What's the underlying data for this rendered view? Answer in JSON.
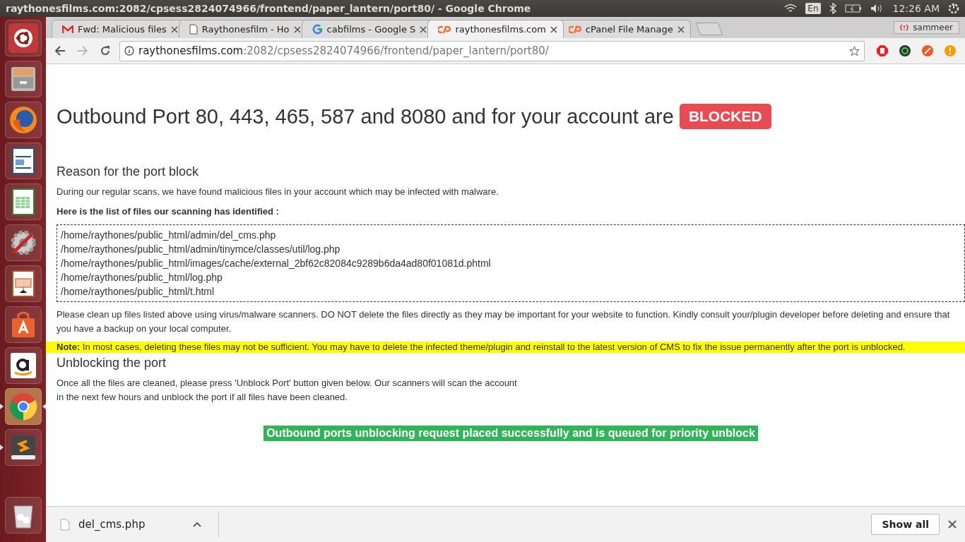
{
  "system_bar": {
    "window_title": "raythonesfilms.com:2082/cpsess2824074966/frontend/paper_lantern/port80/ - Google Chrome",
    "keyboard": "En",
    "time": "12:26 AM"
  },
  "launcher": [
    {
      "kind": "ubuntu",
      "running": false,
      "selected": false
    },
    {
      "kind": "files",
      "running": false,
      "selected": false
    },
    {
      "kind": "firefox",
      "running": false,
      "selected": false
    },
    {
      "kind": "writer",
      "running": false,
      "selected": false
    },
    {
      "kind": "calc",
      "running": false,
      "selected": false
    },
    {
      "kind": "settings",
      "running": false,
      "selected": false
    },
    {
      "kind": "impress",
      "running": false,
      "selected": false
    },
    {
      "kind": "store",
      "running": false,
      "selected": false
    },
    {
      "kind": "amazon",
      "running": false,
      "selected": false
    },
    {
      "kind": "chrome",
      "running": true,
      "selected": true
    },
    {
      "kind": "sublime",
      "running": true,
      "selected": false
    },
    {
      "kind": "trash",
      "running": false,
      "selected": false
    }
  ],
  "tabs": [
    {
      "title": "Fwd: Malicious files",
      "kind": "gmail",
      "selected": false
    },
    {
      "title": "Raythonesfilm - Ho",
      "kind": "page",
      "selected": false
    },
    {
      "title": "cabfilms - Google S",
      "kind": "google",
      "selected": false
    },
    {
      "title": "raythonesfilms.com",
      "kind": "cpanel",
      "selected": true
    },
    {
      "title": "cPanel File Manage",
      "kind": "cpanel",
      "selected": false
    }
  ],
  "profile": "sammeer",
  "address": {
    "host": "raythonesfilms.com",
    "path": ":2082/cpsess2824074966/frontend/paper_lantern/port80/"
  },
  "page": {
    "heading": "Outbound Port 80, 443, 465, 587 and 8080 and for your account are",
    "badge": "BLOCKED",
    "reason_title": "Reason for the port block",
    "reason_text": "During our regular scans, we have found malicious files in your account which may be infected with malware.",
    "list_intro": "Here is the list of files our scanning has identified :",
    "files": [
      "/home/raythones/public_html/admin/del_cms.php",
      "/home/raythones/public_html/admin/tinymce/classes/util/log.php",
      "/home/raythones/public_html/images/cache/external_2bf62c82084c9289b6da4ad80f01081d.phtml",
      "/home/raythones/public_html/log.php",
      "/home/raythones/public_html/t.html"
    ],
    "cleanup_text": "Please clean up files listed above using virus/malware scanners. DO NOT delete the files directly as they may be important for your website to function. Kindly consult your/plugin developer before deleting and ensure that you have a backup on your local computer.",
    "note": "**Note:** In most cases, deleting these files may not be sufficient. You may have to delete the infected theme/plugin and reinstall to the latest version of CMS to fix the issue permanently after the port is unblocked.",
    "unblock_title": "Unblocking the port",
    "unblock_lines": [
      "Once all the files are cleaned, please press 'Unblock Port' button given below. Our scanners will scan the account",
      "in the next few hours and unblock the port if all files have been cleaned."
    ],
    "success": "Outbound ports unblocking request placed successfully and is queued for priority unblock"
  },
  "download_bar": {
    "file": "del_cms.php",
    "show_all": "Show all"
  }
}
